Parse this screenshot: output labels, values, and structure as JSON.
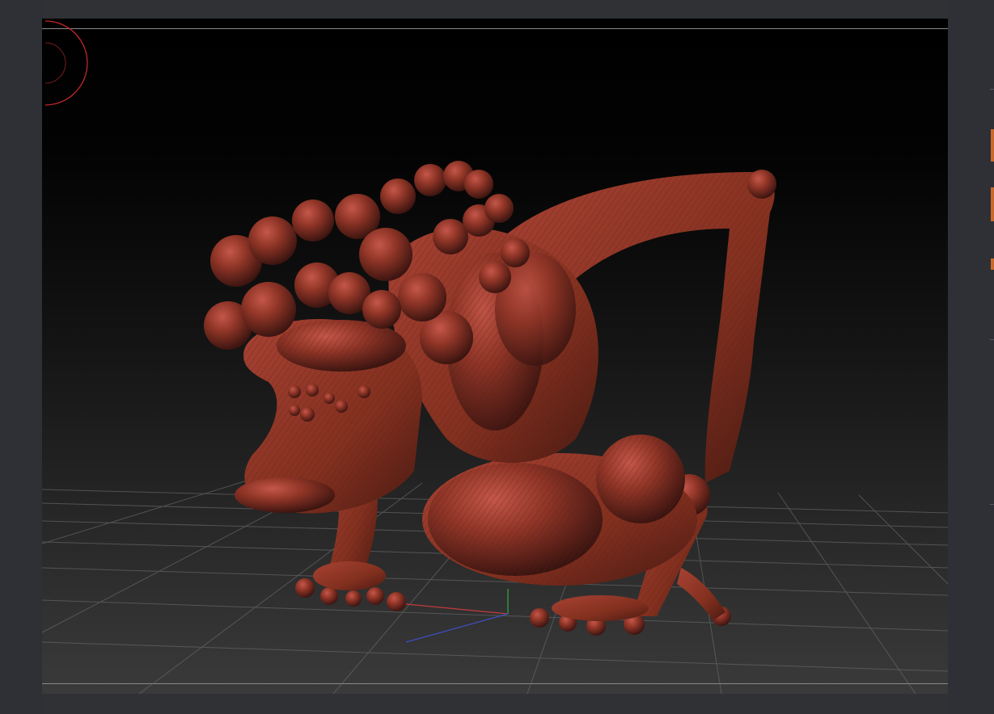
{
  "document": {
    "canvas_label": "",
    "model": "zsphere-creature"
  },
  "colors": {
    "interface_bg": "#303236",
    "canvas_top": "#000000",
    "canvas_bottom": "#3a3a3a",
    "model_material": "#8e3426",
    "brush_cursor": "#c0272d",
    "axis_x": "#c23b3b",
    "axis_y": "#2fa84a",
    "axis_z": "#3f4fc7",
    "tray_accent": "#c8692b"
  },
  "icons": {
    "brush": "brush-circle-icon"
  }
}
